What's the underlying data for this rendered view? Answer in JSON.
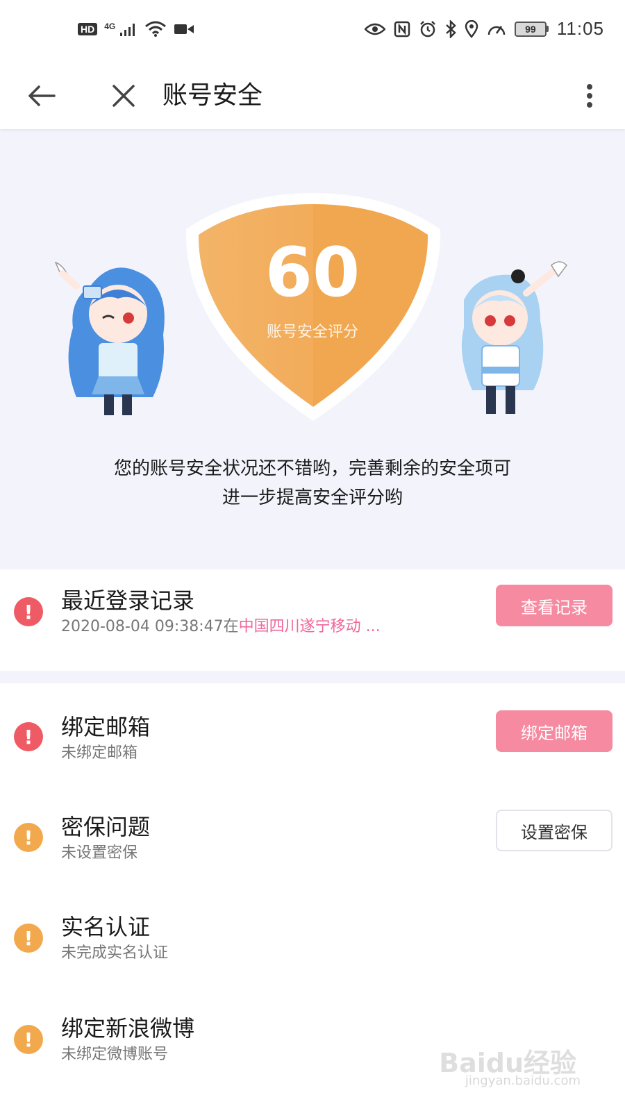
{
  "status_bar": {
    "hd": "HD",
    "network": "4G",
    "battery": "99",
    "time": "11:05",
    "icons": [
      "signal-icon",
      "wifi-icon",
      "video-icon",
      "eye-icon",
      "nfc-icon",
      "alarm-icon",
      "bluetooth-icon",
      "location-icon",
      "speed-icon",
      "battery-icon"
    ]
  },
  "app_bar": {
    "title": "账号安全",
    "icons": [
      "back-arrow-icon",
      "close-icon",
      "more-vert-icon"
    ]
  },
  "hero": {
    "score": "60",
    "score_label": "账号安全评分",
    "message": "您的账号安全状况还不错哟，完善剩余的安全项可进一步提高安全评分哟",
    "message_line1": "您的账号安全状况还不错哟，完善剩余的安全项可",
    "message_line2": "进一步提高安全评分哟",
    "shield_color": "#f2ac5a"
  },
  "login_record": {
    "title": "最近登录记录",
    "time": "2020-08-04 09:38:47在",
    "location": "中国四川遂宁移动 ...",
    "button": "查看记录",
    "status": "red"
  },
  "items": [
    {
      "title": "绑定邮箱",
      "subtitle": "未绑定邮箱",
      "button": "绑定邮箱",
      "status": "red",
      "button_style": "pink"
    },
    {
      "title": "密保问题",
      "subtitle": "未设置密保",
      "button": "设置密保",
      "status": "orange",
      "button_style": "outline"
    },
    {
      "title": "实名认证",
      "subtitle": "未完成实名认证",
      "status": "orange"
    },
    {
      "title": "绑定新浪微博",
      "subtitle": "未绑定微博账号",
      "status": "orange"
    }
  ],
  "alert_symbol": "!",
  "watermark": {
    "brand": "Baidu经验",
    "url": "jingyan.baidu.com"
  },
  "colors": {
    "hero_bg": "#f3f3fc",
    "alert_red": "#ef5b64",
    "alert_orange": "#f2a94e",
    "button_pink": "#f58aa0",
    "location_pink": "#f0679a"
  }
}
